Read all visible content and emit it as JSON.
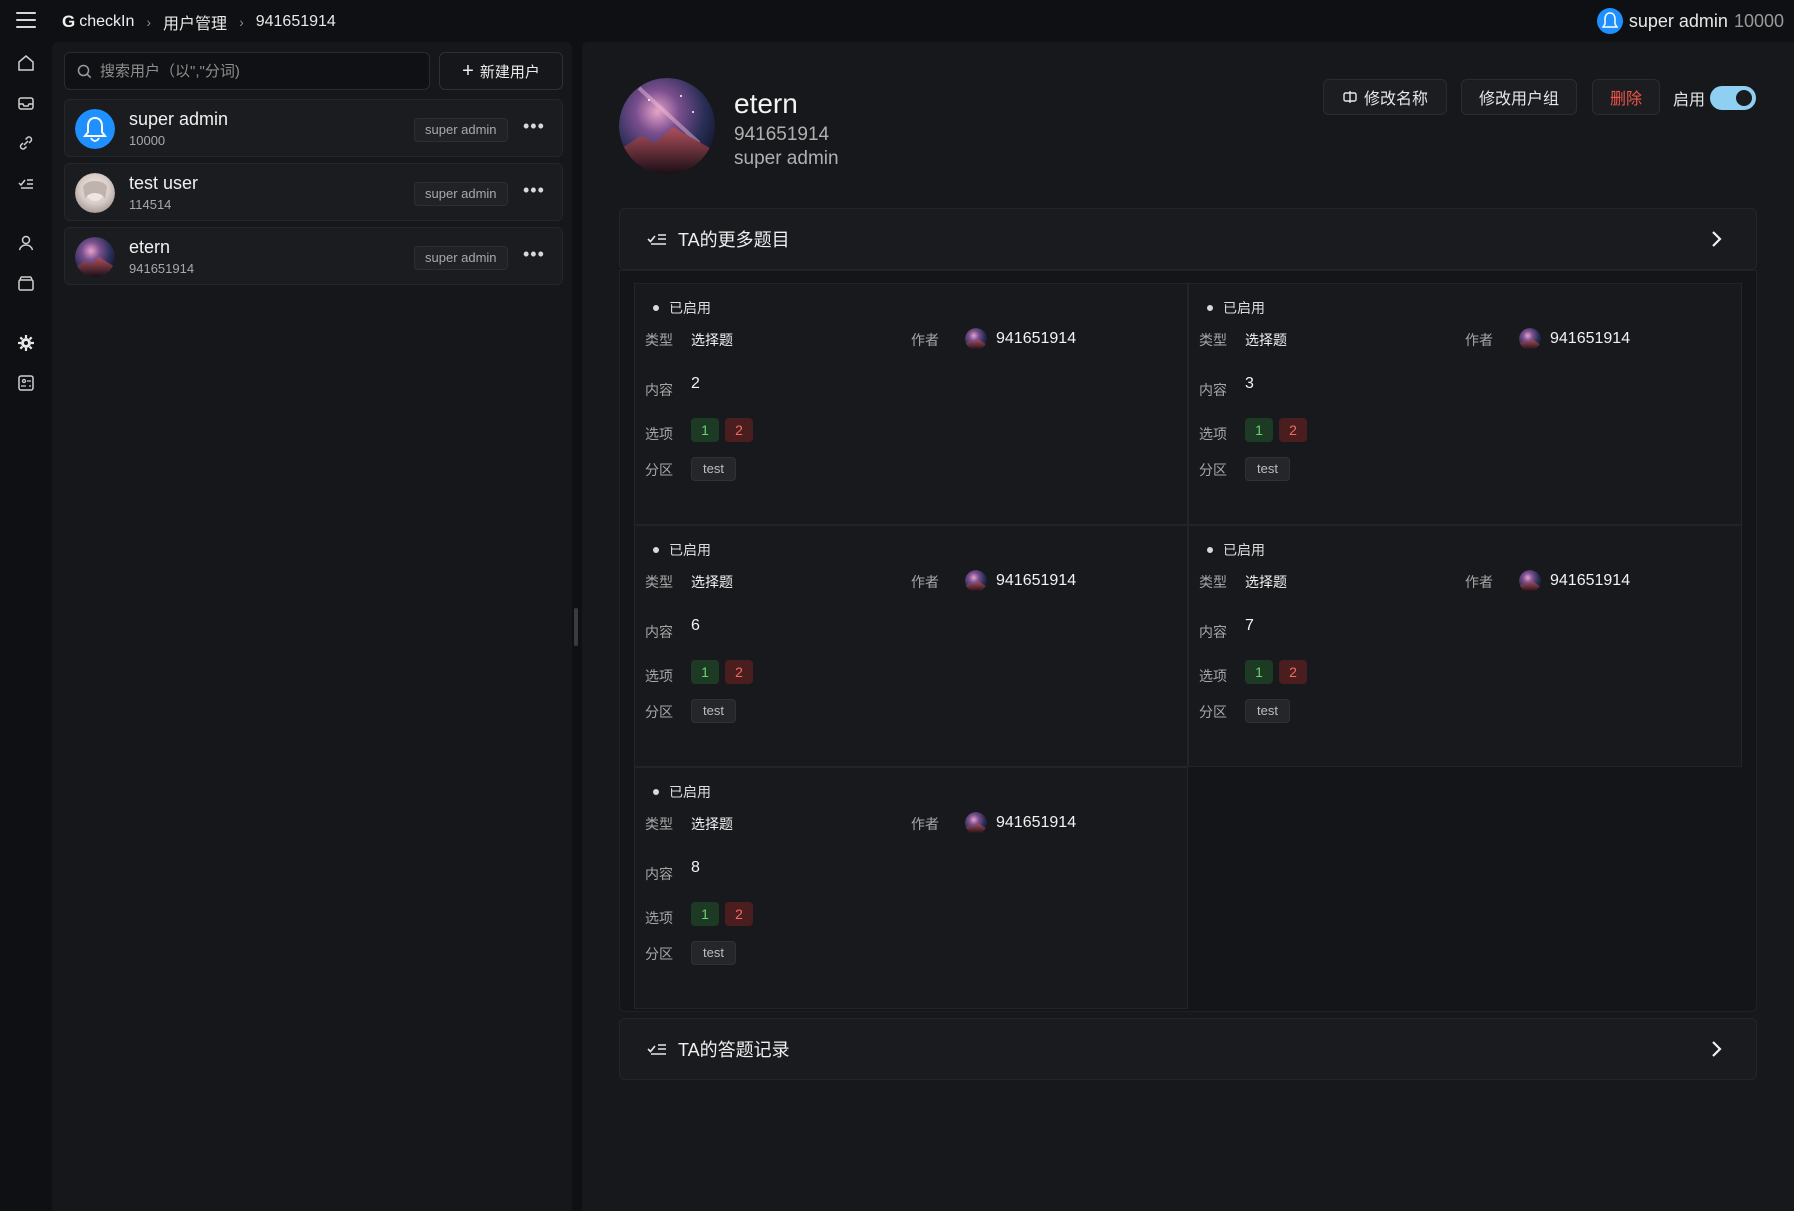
{
  "header": {
    "app_name": "checkIn",
    "logo_glyph": "G",
    "breadcrumb": [
      "用户管理",
      "941651914"
    ],
    "current_user": {
      "name": "super admin",
      "id": "10000"
    }
  },
  "sidebar_icons": [
    "home-icon",
    "inbox-icon",
    "link-icon",
    "checklist-icon",
    "user-icon",
    "archive-icon",
    "gear-icon",
    "settings-panel-icon"
  ],
  "user_list": {
    "search_placeholder": "搜索用户（以\",\"分词)",
    "new_user_label": "新建用户",
    "users": [
      {
        "name": "super admin",
        "id": "10000",
        "group": "super admin",
        "avatar": "default-blue"
      },
      {
        "name": "test user",
        "id": "114514",
        "group": "super admin",
        "avatar": "photo"
      },
      {
        "name": "etern",
        "id": "941651914",
        "group": "super admin",
        "avatar": "galaxy"
      }
    ],
    "more_glyph": "•••"
  },
  "detail": {
    "name": "etern",
    "id": "941651914",
    "group": "super admin",
    "actions": {
      "rename": "修改名称",
      "change_group": "修改用户组",
      "delete": "删除",
      "enable": "启用"
    },
    "enabled": true,
    "sections": {
      "more_questions": "TA的更多题目",
      "answer_records": "TA的答题记录"
    },
    "labels": {
      "type": "类型",
      "author": "作者",
      "content": "内容",
      "options": "选项",
      "section": "分区"
    },
    "questions": [
      {
        "status": "已启用",
        "type": "选择题",
        "author": "941651914",
        "content": "2",
        "options": [
          "1",
          "2"
        ],
        "section": "test"
      },
      {
        "status": "已启用",
        "type": "选择题",
        "author": "941651914",
        "content": "3",
        "options": [
          "1",
          "2"
        ],
        "section": "test"
      },
      {
        "status": "已启用",
        "type": "选择题",
        "author": "941651914",
        "content": "6",
        "options": [
          "1",
          "2"
        ],
        "section": "test"
      },
      {
        "status": "已启用",
        "type": "选择题",
        "author": "941651914",
        "content": "7",
        "options": [
          "1",
          "2"
        ],
        "section": "test"
      },
      {
        "status": "已启用",
        "type": "选择题",
        "author": "941651914",
        "content": "8",
        "options": [
          "1",
          "2"
        ],
        "section": "test"
      }
    ]
  },
  "colors": {
    "background": "#0f1013",
    "panel": "#17181c",
    "accent_blue": "#1e90ff",
    "toggle_on": "#8fd0f2",
    "danger": "#f0554a",
    "option_correct": "#69d36e",
    "option_wrong": "#f06a66"
  }
}
